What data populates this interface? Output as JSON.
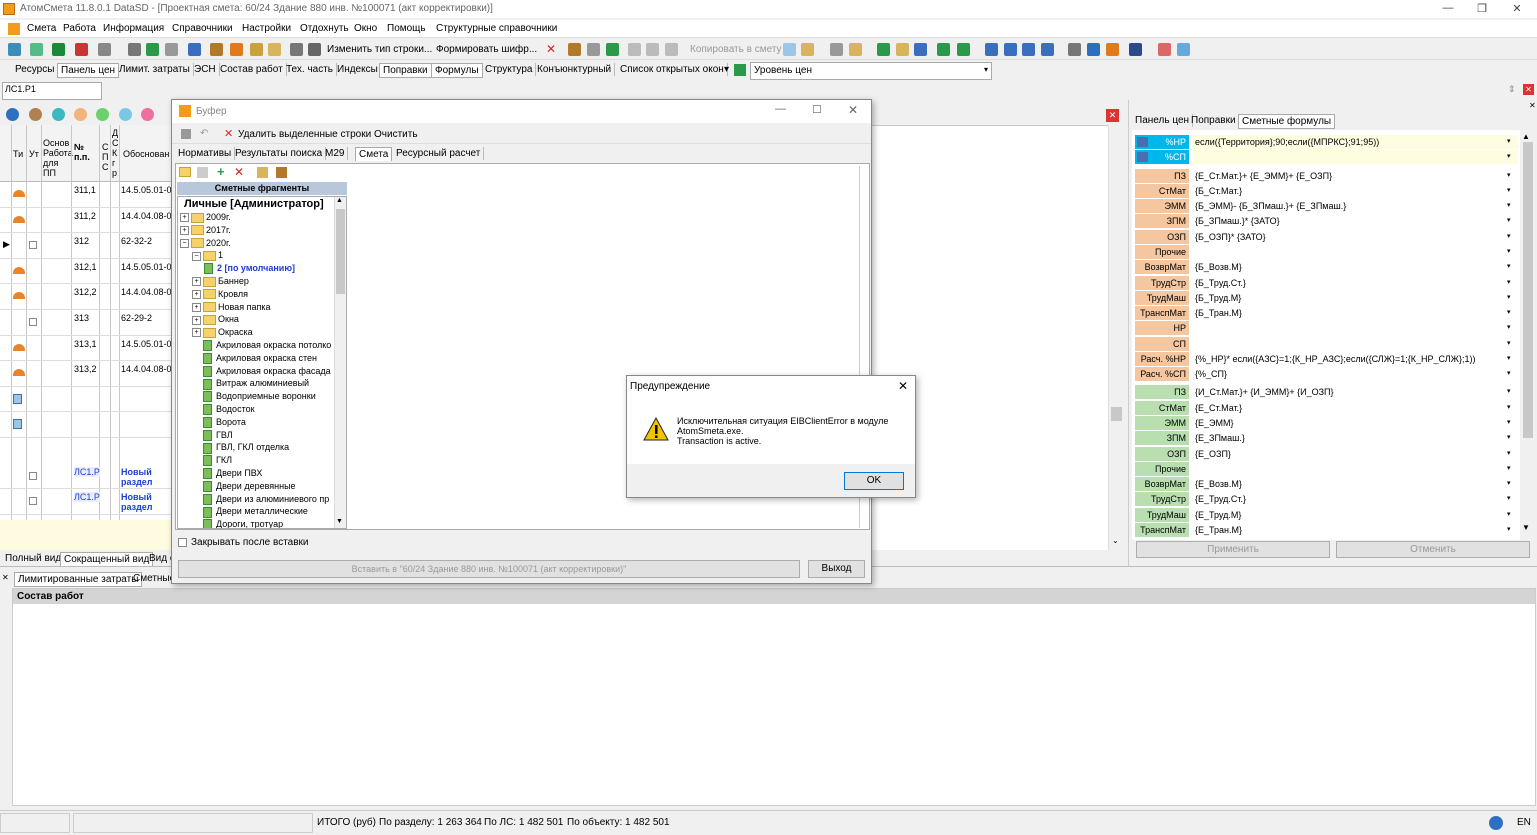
{
  "title_bar": {
    "app": "АтомСмета",
    "version": "11.8.0.1",
    "db": "DataSD",
    "doc": "[Проектная смета: 60/24 Здание 880 инв. №100071 (акт корректировки)]"
  },
  "menu": [
    "Смета",
    "Работа",
    "Информация",
    "Справочники",
    "Настройки",
    "Отдохнуть",
    "Окно",
    "Помощь",
    "Структурные справочники"
  ],
  "toolbar": {
    "change_row_type": "Изменить тип строки...",
    "make_cipher": "Формировать шифр...",
    "copy_to_estimate": "Копировать в смету"
  },
  "panel_tabs": [
    "Ресурсы",
    "Панель цен",
    "Лимит. затраты",
    "ЭСН",
    "Состав работ",
    "Тех. часть",
    "Индексы",
    "Поправки",
    "Формулы",
    "Структура",
    "Конъюнктурный",
    "Список открытых окон"
  ],
  "open_windows_arrow": "▾",
  "price_level": "Уровень цен",
  "section_field": "ЛС1.Р1",
  "grid_headers": {
    "ti": "Ти",
    "ut": "Ут",
    "basis_pp": "Основ Работа для ПП",
    "num": "№ п.п.",
    "spc": "С П С",
    "dskg": "Д С К г р",
    "basis": "Обоснован"
  },
  "grid_rows": [
    {
      "num": "311,1",
      "basis": "14.5.05.01-0"
    },
    {
      "num": "311,2",
      "basis": "14.4.04.08-0"
    },
    {
      "num": "312",
      "basis": "62-32-2"
    },
    {
      "num": "312,1",
      "basis": "14.5.05.01-0"
    },
    {
      "num": "312,2",
      "basis": "14.4.04.08-0"
    },
    {
      "num": "313",
      "basis": "62-29-2"
    },
    {
      "num": "313,1",
      "basis": "14.5.05.01-0"
    },
    {
      "num": "313,2",
      "basis": "14.4.04.08-0"
    },
    {
      "num": "",
      "basis": ""
    },
    {
      "num": "",
      "basis": ""
    },
    {
      "num": "ЛС1.Р",
      "basis": "Новый раздел"
    },
    {
      "num": "ЛС1.Р",
      "basis": "Новый раздел"
    }
  ],
  "view_tabs": [
    "Полный вид",
    "Сокращенный вид",
    "Вид с"
  ],
  "bottom_tabs": [
    "Лимитированные затраты",
    "Сметные"
  ],
  "bottom_header": "Состав работ",
  "status_bar": {
    "total": "ИТОГО (руб)",
    "by_section": "По разделу: 1 263 364",
    "by_ls": "По ЛС: 1 482 501",
    "by_object": "По объекту: 1 482 501",
    "lang": "EN"
  },
  "buffer": {
    "title": "Буфер",
    "delete_selected": "Удалить выделенные строки",
    "clear": "Очистить",
    "tabs": [
      "Нормативы",
      "Результаты поиска",
      "М29",
      "Смета",
      "Ресурсный расчет"
    ],
    "tree_header": "Сметные фрагменты",
    "tree_root": "Личные [Администратор]",
    "tree": [
      {
        "label": "2009г.",
        "kind": "folder",
        "level": 0
      },
      {
        "label": "2017г.",
        "kind": "folder",
        "level": 0
      },
      {
        "label": "2020г.",
        "kind": "folder",
        "level": 0
      },
      {
        "label": "1",
        "kind": "folder",
        "level": 1
      },
      {
        "label": "2 [по умолчанию]",
        "kind": "doc",
        "level": 2
      },
      {
        "label": "Баннер",
        "kind": "folder",
        "level": 1
      },
      {
        "label": "Кровля",
        "kind": "folder",
        "level": 1
      },
      {
        "label": "Новая папка",
        "kind": "folder",
        "level": 1
      },
      {
        "label": "Окна",
        "kind": "folder",
        "level": 1
      },
      {
        "label": "Окраска",
        "kind": "folder",
        "level": 1
      },
      {
        "label": "Акриловая окраска потолко",
        "kind": "doc",
        "level": 1
      },
      {
        "label": "Акриловая окраска стен",
        "kind": "doc",
        "level": 1
      },
      {
        "label": "Акриловая окраска фасада",
        "kind": "doc",
        "level": 1
      },
      {
        "label": "Витраж алюминиевый",
        "kind": "doc",
        "level": 1
      },
      {
        "label": "Водоприемные воронки",
        "kind": "doc",
        "level": 1
      },
      {
        "label": "Водосток",
        "kind": "doc",
        "level": 1
      },
      {
        "label": "Ворота",
        "kind": "doc",
        "level": 1
      },
      {
        "label": "ГВЛ",
        "kind": "doc",
        "level": 1
      },
      {
        "label": "ГВЛ, ГКЛ отделка",
        "kind": "doc",
        "level": 1
      },
      {
        "label": "ГКЛ",
        "kind": "doc",
        "level": 1
      },
      {
        "label": "Двери ПВХ",
        "kind": "doc",
        "level": 1
      },
      {
        "label": "Двери деревянные",
        "kind": "doc",
        "level": 1
      },
      {
        "label": "Двери из алюминиевого пр",
        "kind": "doc",
        "level": 1
      },
      {
        "label": "Двери металлические",
        "kind": "doc",
        "level": 1
      },
      {
        "label": "Дороги, тротуар",
        "kind": "doc",
        "level": 1
      }
    ],
    "close_after_insert": "Закрывать после вставки",
    "insert_into": "Вставить в \"60/24 Здание 880 инв. №100071 (акт корректировки)\"",
    "exit": "Выход"
  },
  "dialog": {
    "title": "Предупреждение",
    "line1": "Исключительная ситуация EIBClientError в модуле",
    "line2": "AtomSmeta.exe.",
    "line3": "Transaction is active.",
    "ok": "OK"
  },
  "right_panel": {
    "tabs": [
      "Панель цен",
      "Поправки",
      "Сметные формулы"
    ],
    "rows": [
      {
        "label": "%НР",
        "value": "если({Территория};90;если({МПРКС};91;95))",
        "color": "#00b7eb"
      },
      {
        "label": "%СП",
        "value": "",
        "color": "#00b7eb"
      },
      {
        "label": "ПЗ",
        "value": "{Е_Ст.Мат.}+ {Е_ЭММ}+ {Е_ОЗП}",
        "color": "#f4c7a1"
      },
      {
        "label": "СтМат",
        "value": "{Б_Ст.Мат.}",
        "color": "#f4c7a1"
      },
      {
        "label": "ЭММ",
        "value": "{Б_ЭММ}- {Б_ЗПмаш.}+ {Е_ЗПмаш.}",
        "color": "#f4c7a1"
      },
      {
        "label": "ЗПМ",
        "value": "{Б_ЗПмаш.}* {ЗАТО}",
        "color": "#f4c7a1"
      },
      {
        "label": "ОЗП",
        "value": "{Б_ОЗП}* {ЗАТО}",
        "color": "#f4c7a1"
      },
      {
        "label": "Прочие",
        "value": "",
        "color": "#f4c7a1"
      },
      {
        "label": "ВозврМат",
        "value": "{Б_Возв.М}",
        "color": "#f4c7a1"
      },
      {
        "label": "ТрудСтр",
        "value": "{Б_Труд.Ст.}",
        "color": "#f4c7a1"
      },
      {
        "label": "ТрудМаш",
        "value": "{Б_Труд.М}",
        "color": "#f4c7a1"
      },
      {
        "label": "ТранспМат",
        "value": "{Б_Тран.М}",
        "color": "#f4c7a1"
      },
      {
        "label": "НР",
        "value": "",
        "color": "#f4c7a1"
      },
      {
        "label": "СП",
        "value": "",
        "color": "#f4c7a1"
      },
      {
        "label": "Расч. %НР",
        "value": "{%_НР}* если({АЗС}=1;{К_НР_АЗС};если({СЛЖ}=1;{К_НР_СЛЖ};1))",
        "color": "#f4c7a1"
      },
      {
        "label": "Расч. %СП",
        "value": "{%_СП}",
        "color": "#f4c7a1"
      },
      {
        "label": "ПЗ",
        "value": "{И_Ст.Мат.}+ {И_ЭММ}+ {И_ОЗП}",
        "color": "#b9dfb1"
      },
      {
        "label": "СтМат",
        "value": "{Е_Ст.Мат.}",
        "color": "#b9dfb1"
      },
      {
        "label": "ЭММ",
        "value": "{Е_ЭММ}",
        "color": "#b9dfb1"
      },
      {
        "label": "ЗПМ",
        "value": "{Е_ЗПмаш.}",
        "color": "#b9dfb1"
      },
      {
        "label": "ОЗП",
        "value": "{Е_ОЗП}",
        "color": "#b9dfb1"
      },
      {
        "label": "Прочие",
        "value": "",
        "color": "#b9dfb1"
      },
      {
        "label": "ВозврМат",
        "value": "{Е_Возв.М}",
        "color": "#b9dfb1"
      },
      {
        "label": "ТрудСтр",
        "value": "{Е_Труд.Ст.}",
        "color": "#b9dfb1"
      },
      {
        "label": "ТрудМаш",
        "value": "{Е_Труд.М}",
        "color": "#b9dfb1"
      },
      {
        "label": "ТранспМат",
        "value": "{Е_Тран.М}",
        "color": "#b9dfb1"
      }
    ],
    "apply": "Применить",
    "cancel": "Отменить"
  }
}
